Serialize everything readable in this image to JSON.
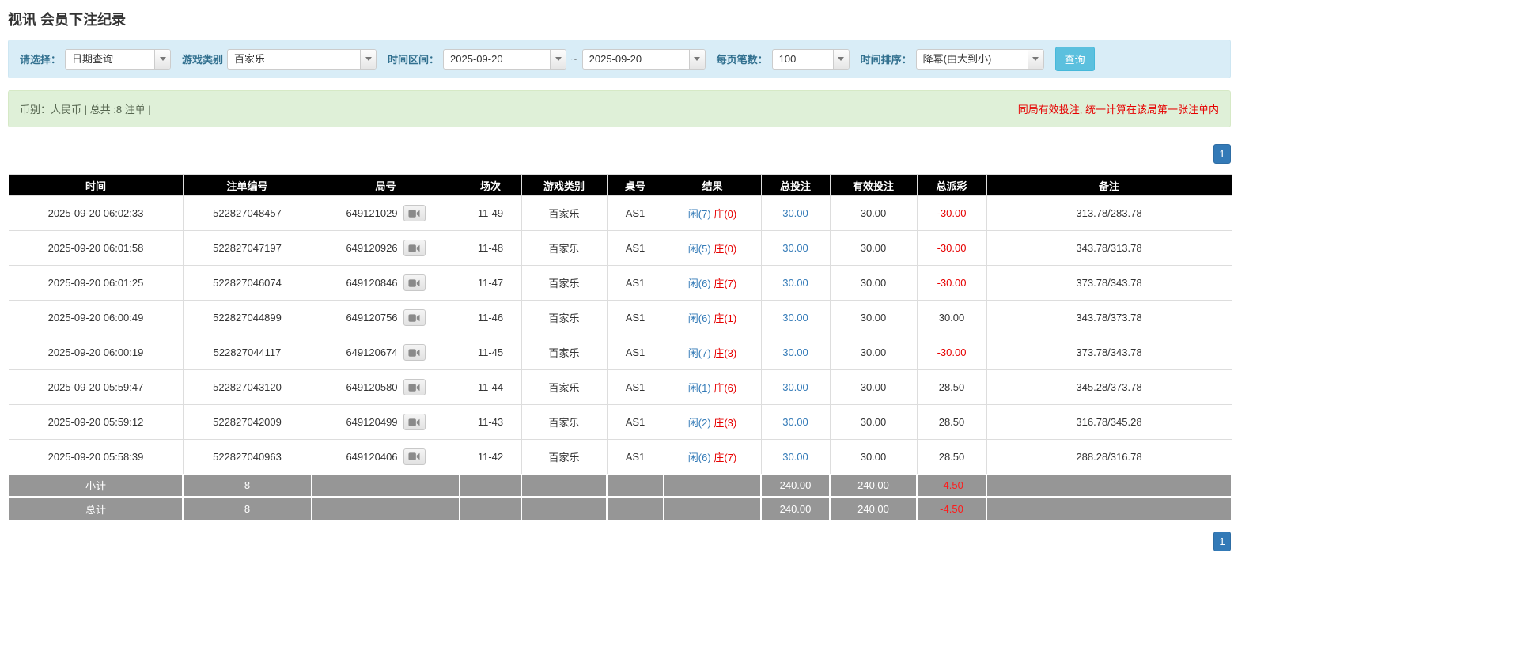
{
  "page": {
    "title": "视讯 会员下注纪录"
  },
  "colors": {
    "accent_blue": "#337ab7",
    "banker_red": "#e60000",
    "table_header_bg": "#000000",
    "footer_row_bg": "#969696",
    "filter_bar_bg": "#d9edf7",
    "summary_bar_bg": "#dff0d8",
    "search_button_bg": "#5bc0de"
  },
  "filters": {
    "select_label": "请选择：",
    "select_value": "日期查询",
    "game_type_label": "游戏类别",
    "game_type_value": "百家乐",
    "time_range_label": "时间区间：",
    "date_from": "2025-09-20",
    "date_separator": "~",
    "date_to": "2025-09-20",
    "page_size_label": "每页笔数：",
    "page_size_value": "100",
    "sort_label": "时间排序：",
    "sort_value": "降幂(由大到小)",
    "search_button": "查询"
  },
  "summary": {
    "left": "币别：人民币 | 总共 :8 注单 |",
    "right": "同局有效投注, 统一计算在该局第一张注单内"
  },
  "pagination": {
    "page": "1"
  },
  "table": {
    "headers": [
      "时间",
      "注单编号",
      "局号",
      "场次",
      "游戏类别",
      "桌号",
      "结果",
      "总投注",
      "有效投注",
      "总派彩",
      "备注"
    ],
    "rows": [
      {
        "time": "2025-09-20 06:02:33",
        "bet_id": "522827048457",
        "round_id": "649121029",
        "session": "11-49",
        "game": "百家乐",
        "table_no": "AS1",
        "result": {
          "player": "闲(7)",
          "banker": "庄(0)"
        },
        "total_bet": "30.00",
        "valid_bet": "30.00",
        "payout": "-30.00",
        "note": "313.78/283.78"
      },
      {
        "time": "2025-09-20 06:01:58",
        "bet_id": "522827047197",
        "round_id": "649120926",
        "session": "11-48",
        "game": "百家乐",
        "table_no": "AS1",
        "result": {
          "player": "闲(5)",
          "banker": "庄(0)"
        },
        "total_bet": "30.00",
        "valid_bet": "30.00",
        "payout": "-30.00",
        "note": "343.78/313.78"
      },
      {
        "time": "2025-09-20 06:01:25",
        "bet_id": "522827046074",
        "round_id": "649120846",
        "session": "11-47",
        "game": "百家乐",
        "table_no": "AS1",
        "result": {
          "player": "闲(6)",
          "banker": "庄(7)"
        },
        "total_bet": "30.00",
        "valid_bet": "30.00",
        "payout": "-30.00",
        "note": "373.78/343.78"
      },
      {
        "time": "2025-09-20 06:00:49",
        "bet_id": "522827044899",
        "round_id": "649120756",
        "session": "11-46",
        "game": "百家乐",
        "table_no": "AS1",
        "result": {
          "player": "闲(6)",
          "banker": "庄(1)"
        },
        "total_bet": "30.00",
        "valid_bet": "30.00",
        "payout": "30.00",
        "note": "343.78/373.78"
      },
      {
        "time": "2025-09-20 06:00:19",
        "bet_id": "522827044117",
        "round_id": "649120674",
        "session": "11-45",
        "game": "百家乐",
        "table_no": "AS1",
        "result": {
          "player": "闲(7)",
          "banker": "庄(3)"
        },
        "total_bet": "30.00",
        "valid_bet": "30.00",
        "payout": "-30.00",
        "note": "373.78/343.78"
      },
      {
        "time": "2025-09-20 05:59:47",
        "bet_id": "522827043120",
        "round_id": "649120580",
        "session": "11-44",
        "game": "百家乐",
        "table_no": "AS1",
        "result": {
          "player": "闲(1)",
          "banker": "庄(6)"
        },
        "total_bet": "30.00",
        "valid_bet": "30.00",
        "payout": "28.50",
        "note": "345.28/373.78"
      },
      {
        "time": "2025-09-20 05:59:12",
        "bet_id": "522827042009",
        "round_id": "649120499",
        "session": "11-43",
        "game": "百家乐",
        "table_no": "AS1",
        "result": {
          "player": "闲(2)",
          "banker": "庄(3)"
        },
        "total_bet": "30.00",
        "valid_bet": "30.00",
        "payout": "28.50",
        "note": "316.78/345.28"
      },
      {
        "time": "2025-09-20 05:58:39",
        "bet_id": "522827040963",
        "round_id": "649120406",
        "session": "11-42",
        "game": "百家乐",
        "table_no": "AS1",
        "result": {
          "player": "闲(6)",
          "banker": "庄(7)"
        },
        "total_bet": "30.00",
        "valid_bet": "30.00",
        "payout": "28.50",
        "note": "288.28/316.78"
      }
    ],
    "subtotal": {
      "label": "小计",
      "count": "8",
      "total_bet": "240.00",
      "valid_bet": "240.00",
      "payout": "-4.50"
    },
    "total": {
      "label": "总计",
      "count": "8",
      "total_bet": "240.00",
      "valid_bet": "240.00",
      "payout": "-4.50"
    }
  }
}
